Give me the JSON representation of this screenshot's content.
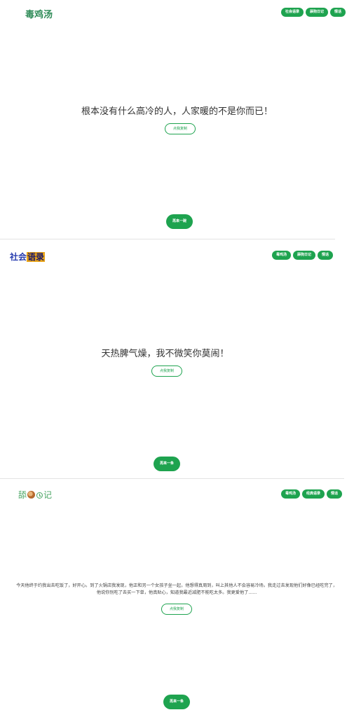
{
  "panels": [
    {
      "logo": {
        "text": "毒鸡汤"
      },
      "nav": [
        "社会语录",
        "舔狗日记",
        "情话"
      ],
      "quote": "根本没有什么高冷的人，人家暖的不是你而已！",
      "copy_label": "点我复制",
      "next_label": "再来一碗"
    },
    {
      "logo": {
        "part1": "社会",
        "part2": "语录"
      },
      "nav": [
        "毒鸡汤",
        "舔狗日记",
        "情话"
      ],
      "quote": "天热脾气燥，我不微笑你莫闹！",
      "copy_label": "点我复制",
      "next_label": "再来一条"
    },
    {
      "logo": {
        "part1": "舔",
        "part2": "记"
      },
      "nav": [
        "毒鸡汤",
        "经典语录",
        "情话"
      ],
      "quote": "今天他终于约我出去吃饭了，好开心。到了火锅店我发现，他正和另一个女孩子坐一起，他想得真周到，叫上其他人不会容易冷场。我走过去发现他们好像已经吃完了，他说你别吃了去买一下单，他真贴心，知道我最近减肥不能吃太多。我更爱他了......",
      "copy_label": "点我复制",
      "next_label": "再来一条"
    }
  ],
  "colors": {
    "accent": "#1ea34f",
    "logo1": "#2e8b57",
    "logo2_blue": "#2a3fb0",
    "logo2_orange": "#e8a317",
    "logo3": "#4aa564"
  },
  "icons": {
    "logo3_dog": "dog-face-icon",
    "logo3_clock": "clock-icon"
  }
}
